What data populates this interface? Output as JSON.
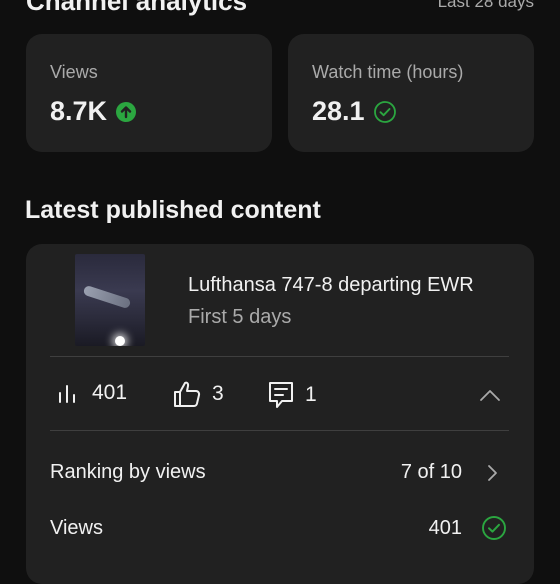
{
  "header": {
    "title": "Channel analytics",
    "range": "Last 28 days"
  },
  "stats": [
    {
      "label": "Views",
      "value": "8.7K",
      "icon": "arrow-up-circle-icon"
    },
    {
      "label": "Watch time (hours)",
      "value": "28.1",
      "icon": "check-circle-outline-icon"
    }
  ],
  "section": {
    "title": "Latest published content"
  },
  "video": {
    "title": "Lufthansa 747-8 departing EWR",
    "subtitle": "First 5 days",
    "metrics": {
      "views": "401",
      "likes": "3",
      "comments": "1"
    }
  },
  "rows": [
    {
      "label": "Ranking by views",
      "value": "7 of 10",
      "icon": "chevron-right-icon"
    },
    {
      "label": "Views",
      "value": "401",
      "icon": "check-circle-outline-icon"
    }
  ],
  "colors": {
    "background": "#0f0f0f",
    "card": "#212121",
    "secondary_text": "#aaaaaa",
    "success_green": "#2ba640"
  }
}
